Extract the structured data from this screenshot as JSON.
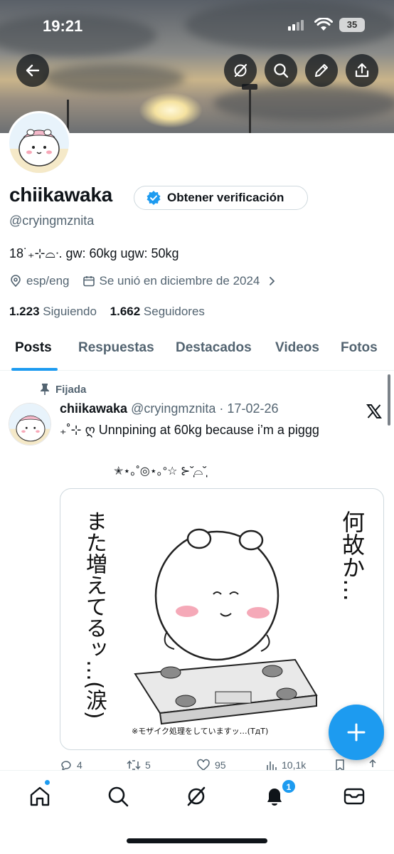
{
  "status_bar": {
    "time": "19:21",
    "battery": "35"
  },
  "profile": {
    "name": "chiikawaka",
    "verify_label": "Obtener verificación",
    "handle": "@cryingmznita",
    "bio": "18˙₊⊹⌓ᐧ. gw: 60kg ugw: 50kg",
    "location": "esp/eng",
    "joined": "Se unió en diciembre de 2024",
    "following_count": "1.223",
    "following_label": "Siguiendo",
    "followers_count": "1.662",
    "followers_label": "Seguidores"
  },
  "tabs": [
    "Posts",
    "Respuestas",
    "Destacados",
    "Videos",
    "Fotos"
  ],
  "post": {
    "pinned_label": "Fijada",
    "author": "chiikawaka",
    "handle": "@cryingmznita",
    "separator": "·",
    "date": "17-02-26",
    "text": "₊˚⊹ ღ Unnpining at 60kg because i’m a piggg",
    "deco": "✭⋆｡˚◎⋆｡°☆ ⊱˘̩̩̩⌓˘̩̩̩",
    "comic_left": "また増えてるッ…(涙)",
    "comic_right": "何故か…",
    "comic_note": "※モザイク処理をしていますッ…(TдT)",
    "stats": {
      "replies": "4",
      "reposts": "5",
      "likes": "95",
      "views": "10,1k"
    }
  },
  "nav": {
    "notifications_badge": "1"
  },
  "colors": {
    "accent": "#1d9bf0",
    "text": "#0f1419",
    "muted": "#536471"
  }
}
